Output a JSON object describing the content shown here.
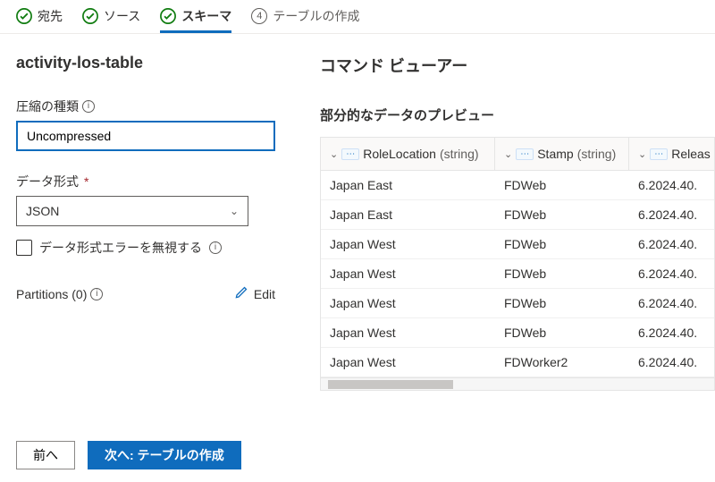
{
  "stepper": {
    "steps": [
      {
        "label": "宛先",
        "state": "done"
      },
      {
        "label": "ソース",
        "state": "done"
      },
      {
        "label": "スキーマ",
        "state": "current"
      },
      {
        "label": "テーブルの作成",
        "state": "pending",
        "num": "4"
      }
    ]
  },
  "left": {
    "table_name": "activity-los-table",
    "compression": {
      "label": "圧縮の種類",
      "value": "Uncompressed"
    },
    "format": {
      "label": "データ形式",
      "value": "JSON"
    },
    "ignore_errors": {
      "label": "データ形式エラーを無視する",
      "checked": false
    },
    "partitions": {
      "label": "Partitions (0)",
      "edit": "Edit"
    }
  },
  "right": {
    "cmd_title": "コマンド ビューアー",
    "preview_title": "部分的なデータのプレビュー",
    "columns": [
      {
        "name": "RoleLocation",
        "type": "(string)"
      },
      {
        "name": "Stamp",
        "type": "(string)"
      },
      {
        "name": "Releas",
        "type": ""
      }
    ],
    "rows": [
      {
        "c0": "Japan East",
        "c1": "FDWeb",
        "c2": "6.2024.40."
      },
      {
        "c0": "Japan East",
        "c1": "FDWeb",
        "c2": "6.2024.40."
      },
      {
        "c0": "Japan West",
        "c1": "FDWeb",
        "c2": "6.2024.40."
      },
      {
        "c0": "Japan West",
        "c1": "FDWeb",
        "c2": "6.2024.40."
      },
      {
        "c0": "Japan West",
        "c1": "FDWeb",
        "c2": "6.2024.40."
      },
      {
        "c0": "Japan West",
        "c1": "FDWeb",
        "c2": "6.2024.40."
      },
      {
        "c0": "Japan West",
        "c1": "FDWorker2",
        "c2": "6.2024.40."
      }
    ]
  },
  "footer": {
    "back": "前へ",
    "next": "次へ: テーブルの作成"
  }
}
